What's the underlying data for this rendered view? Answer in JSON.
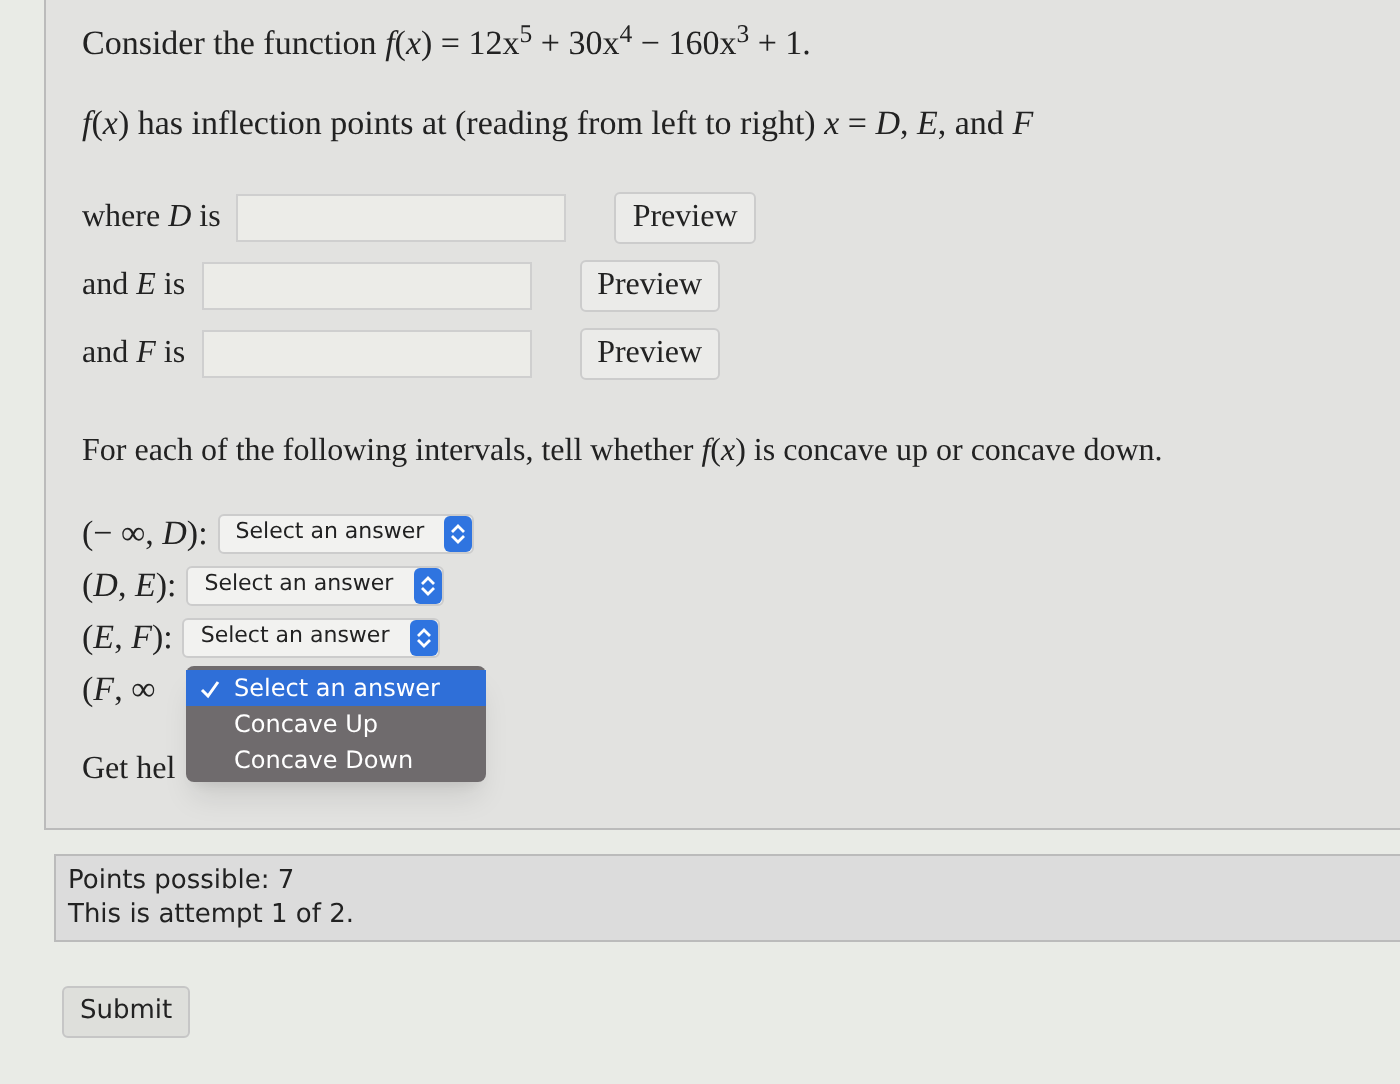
{
  "question": {
    "prompt": "Consider the function *f*(*x*) = 12x$^{5}$ + 30x$^{4}$ − 160x$^{3}$ + 1.",
    "statement": "*f*(*x*) has inflection points at (reading from left to right) *x* = *D*, *E*, and *F*",
    "answers": [
      {
        "label": "where *D* is",
        "button": "Preview"
      },
      {
        "label": "and *E* is",
        "button": "Preview"
      },
      {
        "label": "and *F* is",
        "button": "Preview"
      }
    ],
    "instruction": "For each of the following intervals, tell whether *f*(*x*) is concave up or concave down.",
    "intervals": [
      {
        "label": "(− ∞, *D*):",
        "select": "Select an answer"
      },
      {
        "label": "(*D*, *E*):",
        "select": "Select an answer"
      },
      {
        "label": "(*E*, *F*):",
        "select": "Select an answer"
      },
      {
        "label": "(*F*, ∞"
      }
    ],
    "dropdown_menu": [
      {
        "label": "Select an answer",
        "selected": true
      },
      {
        "label": "Concave Up",
        "selected": false
      },
      {
        "label": "Concave Down",
        "selected": false
      }
    ],
    "help": "Get hel"
  },
  "points": {
    "possible": "Points possible: 7",
    "attempt": "This is attempt 1 of 2."
  },
  "submit": "Submit"
}
